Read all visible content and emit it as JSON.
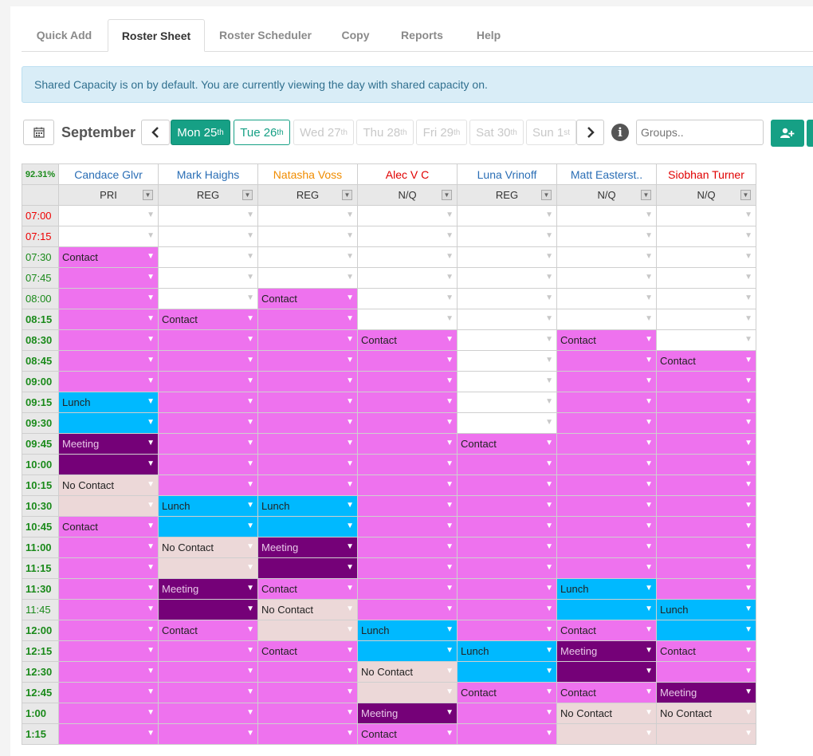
{
  "tabs": [
    {
      "label": "Quick Add",
      "active": false
    },
    {
      "label": "Roster Sheet",
      "active": true
    },
    {
      "label": "Roster Scheduler",
      "active": false
    },
    {
      "label": "Copy",
      "active": false
    },
    {
      "label": "Reports",
      "active": false
    },
    {
      "label": "Help",
      "active": false
    }
  ],
  "alert": "Shared Capacity is on by default. You are currently viewing the day with shared capacity on.",
  "toolbar": {
    "month": "September",
    "days": [
      {
        "label": "Mon 25",
        "sup": "th",
        "state": "active"
      },
      {
        "label": "Tue 26",
        "sup": "th",
        "state": "selected"
      },
      {
        "label": "Wed 27",
        "sup": "th",
        "state": "disabled"
      },
      {
        "label": "Thu 28",
        "sup": "th",
        "state": "disabled"
      },
      {
        "label": "Fri 29",
        "sup": "th",
        "state": "disabled"
      },
      {
        "label": "Sat 30",
        "sup": "th",
        "state": "disabled"
      },
      {
        "label": "Sun 1",
        "sup": "st",
        "state": "disabled"
      }
    ],
    "groups_placeholder": "Groups.."
  },
  "roster": {
    "percent": "92.31%",
    "staff": [
      {
        "name": "Candace Glvr",
        "color": "#2a6eb5",
        "role": "PRI"
      },
      {
        "name": "Mark Haighs",
        "color": "#2a6eb5",
        "role": "REG"
      },
      {
        "name": "Natasha Voss",
        "color": "#f08c00",
        "role": "REG"
      },
      {
        "name": "Alec V C",
        "color": "#e00000",
        "role": "N/Q"
      },
      {
        "name": "Luna Vrinoff",
        "color": "#2a6eb5",
        "role": "REG"
      },
      {
        "name": "Matt Easterst..",
        "color": "#2a6eb5",
        "role": "N/Q"
      },
      {
        "name": "Siobhan Turner",
        "color": "#e00000",
        "role": "N/Q"
      }
    ],
    "rows": [
      {
        "time": "07:00",
        "style": "red",
        "cells": [
          "E",
          "E",
          "E",
          "E",
          "E",
          "E",
          "E"
        ],
        "labels": [
          "",
          "",
          "",
          "",
          "",
          "",
          ""
        ]
      },
      {
        "time": "07:15",
        "style": "red",
        "cells": [
          "E",
          "E",
          "E",
          "E",
          "E",
          "E",
          "E"
        ],
        "labels": [
          "",
          "",
          "",
          "",
          "",
          "",
          ""
        ]
      },
      {
        "time": "07:30",
        "style": "green",
        "cells": [
          "C",
          "E",
          "E",
          "E",
          "E",
          "E",
          "E"
        ],
        "labels": [
          "Contact",
          "",
          "",
          "",
          "",
          "",
          ""
        ]
      },
      {
        "time": "07:45",
        "style": "green",
        "cells": [
          "C",
          "E",
          "E",
          "E",
          "E",
          "E",
          "E"
        ],
        "labels": [
          "",
          "",
          "",
          "",
          "",
          "",
          ""
        ]
      },
      {
        "time": "08:00",
        "style": "green",
        "cells": [
          "C",
          "E",
          "C",
          "E",
          "E",
          "E",
          "E"
        ],
        "labels": [
          "",
          "",
          "Contact",
          "",
          "",
          "",
          ""
        ]
      },
      {
        "time": "08:15",
        "style": "greenbold",
        "cells": [
          "C",
          "C",
          "C",
          "E",
          "E",
          "E",
          "E"
        ],
        "labels": [
          "",
          "Contact",
          "",
          "",
          "",
          "",
          ""
        ]
      },
      {
        "time": "08:30",
        "style": "greenbold",
        "cells": [
          "C",
          "C",
          "C",
          "C",
          "E",
          "C",
          "E"
        ],
        "labels": [
          "",
          "",
          "",
          "Contact",
          "",
          "Contact",
          ""
        ]
      },
      {
        "time": "08:45",
        "style": "greenbold",
        "cells": [
          "C",
          "C",
          "C",
          "C",
          "E",
          "C",
          "C"
        ],
        "labels": [
          "",
          "",
          "",
          "",
          "",
          "",
          "Contact"
        ]
      },
      {
        "time": "09:00",
        "style": "greenbold",
        "cells": [
          "C",
          "C",
          "C",
          "C",
          "E",
          "C",
          "C"
        ],
        "labels": [
          "",
          "",
          "",
          "",
          "",
          "",
          ""
        ]
      },
      {
        "time": "09:15",
        "style": "greenbold",
        "cells": [
          "L",
          "C",
          "C",
          "C",
          "E",
          "C",
          "C"
        ],
        "labels": [
          "Lunch",
          "",
          "",
          "",
          "",
          "",
          ""
        ]
      },
      {
        "time": "09:30",
        "style": "greenbold",
        "cells": [
          "L",
          "C",
          "C",
          "C",
          "E",
          "C",
          "C"
        ],
        "labels": [
          "",
          "",
          "",
          "",
          "",
          "",
          ""
        ]
      },
      {
        "time": "09:45",
        "style": "greenbold",
        "cells": [
          "M",
          "C",
          "C",
          "C",
          "C",
          "C",
          "C"
        ],
        "labels": [
          "Meeting",
          "",
          "",
          "",
          "Contact",
          "",
          ""
        ]
      },
      {
        "time": "10:00",
        "style": "greenbold",
        "cells": [
          "M",
          "C",
          "C",
          "C",
          "C",
          "C",
          "C"
        ],
        "labels": [
          "",
          "",
          "",
          "",
          "",
          "",
          ""
        ]
      },
      {
        "time": "10:15",
        "style": "greenbold",
        "cells": [
          "N",
          "C",
          "C",
          "C",
          "C",
          "C",
          "C"
        ],
        "labels": [
          "No Contact",
          "",
          "",
          "",
          "",
          "",
          ""
        ]
      },
      {
        "time": "10:30",
        "style": "greenbold",
        "cells": [
          "N",
          "L",
          "L",
          "C",
          "C",
          "C",
          "C"
        ],
        "labels": [
          "",
          "Lunch",
          "Lunch",
          "",
          "",
          "",
          ""
        ]
      },
      {
        "time": "10:45",
        "style": "greenbold",
        "cells": [
          "C",
          "L",
          "L",
          "C",
          "C",
          "C",
          "C"
        ],
        "labels": [
          "Contact",
          "",
          "",
          "",
          "",
          "",
          ""
        ]
      },
      {
        "time": "11:00",
        "style": "greenbold",
        "cells": [
          "C",
          "N",
          "M",
          "C",
          "C",
          "C",
          "C"
        ],
        "labels": [
          "",
          "No Contact",
          "Meeting",
          "",
          "",
          "",
          ""
        ]
      },
      {
        "time": "11:15",
        "style": "greenbold",
        "cells": [
          "C",
          "N",
          "M",
          "C",
          "C",
          "C",
          "C"
        ],
        "labels": [
          "",
          "",
          "",
          "",
          "",
          "",
          ""
        ]
      },
      {
        "time": "11:30",
        "style": "greenbold",
        "cells": [
          "C",
          "M",
          "C",
          "C",
          "C",
          "L",
          "C"
        ],
        "labels": [
          "",
          "Meeting",
          "Contact",
          "",
          "",
          "Lunch",
          ""
        ]
      },
      {
        "time": "11:45",
        "style": "green",
        "cells": [
          "C",
          "M",
          "N",
          "C",
          "C",
          "L",
          "L"
        ],
        "labels": [
          "",
          "",
          "No Contact",
          "",
          "",
          "",
          "Lunch"
        ]
      },
      {
        "time": "12:00",
        "style": "greenbold",
        "cells": [
          "C",
          "C",
          "N",
          "L",
          "C",
          "C",
          "L"
        ],
        "labels": [
          "",
          "Contact",
          "",
          "Lunch",
          "",
          "Contact",
          ""
        ]
      },
      {
        "time": "12:15",
        "style": "greenbold",
        "cells": [
          "C",
          "C",
          "C",
          "L",
          "L",
          "M",
          "C"
        ],
        "labels": [
          "",
          "",
          "Contact",
          "",
          "Lunch",
          "Meeting",
          "Contact"
        ]
      },
      {
        "time": "12:30",
        "style": "greenbold",
        "cells": [
          "C",
          "C",
          "C",
          "N",
          "L",
          "M",
          "C"
        ],
        "labels": [
          "",
          "",
          "",
          "No Contact",
          "",
          "",
          ""
        ]
      },
      {
        "time": "12:45",
        "style": "greenbold",
        "cells": [
          "C",
          "C",
          "C",
          "N",
          "C",
          "C",
          "M"
        ],
        "labels": [
          "",
          "",
          "",
          "",
          "Contact",
          "Contact",
          "Meeting"
        ]
      },
      {
        "time": "1:00",
        "style": "greenbold",
        "cells": [
          "C",
          "C",
          "C",
          "M",
          "C",
          "N",
          "N"
        ],
        "labels": [
          "",
          "",
          "",
          "Meeting",
          "",
          "No Contact",
          "No Contact"
        ]
      },
      {
        "time": "1:15",
        "style": "greenbold",
        "cells": [
          "C",
          "C",
          "C",
          "C",
          "C",
          "N",
          "N"
        ],
        "labels": [
          "",
          "",
          "",
          "Contact",
          "",
          "",
          ""
        ]
      }
    ]
  }
}
